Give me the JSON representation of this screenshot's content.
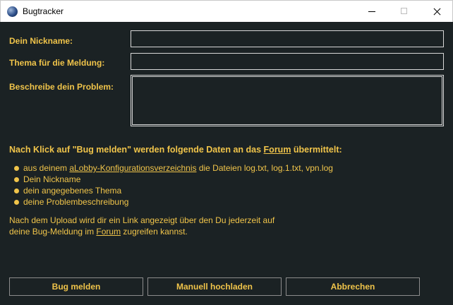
{
  "window": {
    "title": "Bugtracker",
    "icon": "globe-icon"
  },
  "form": {
    "nickname_label": "Dein Nickname:",
    "nickname_value": "",
    "topic_label": "Thema für die Meldung:",
    "topic_value": "",
    "problem_label": "Beschreibe dein Problem:",
    "problem_value": ""
  },
  "info": {
    "heading_prefix": "Nach Klick auf \"Bug melden\" werden folgende Daten an das ",
    "heading_link": "Forum",
    "heading_suffix": " übermittelt:",
    "bullet_1_prefix": "aus deinem ",
    "bullet_1_link": "aLobby-Konfigurationsverzeichnis",
    "bullet_1_suffix": " die Dateien log.txt, log.1.txt, vpn.log",
    "bullet_2": "Dein Nickname",
    "bullet_3": "dein angegebenes Thema",
    "bullet_4": "deine Problembeschreibung",
    "note_line_1": "Nach dem Upload wird dir ein Link angezeigt über den Du jederzeit auf",
    "note_line_2_prefix": "deine Bug-Meldung im ",
    "note_line_2_link": "Forum",
    "note_line_2_suffix": " zugreifen kannst."
  },
  "buttons": {
    "report": "Bug melden",
    "upload": "Manuell hochladen",
    "cancel": "Abbrechen"
  },
  "colors": {
    "background": "#1b2224",
    "accent_text": "#f0c44a",
    "field_border": "#d8d8d8"
  }
}
